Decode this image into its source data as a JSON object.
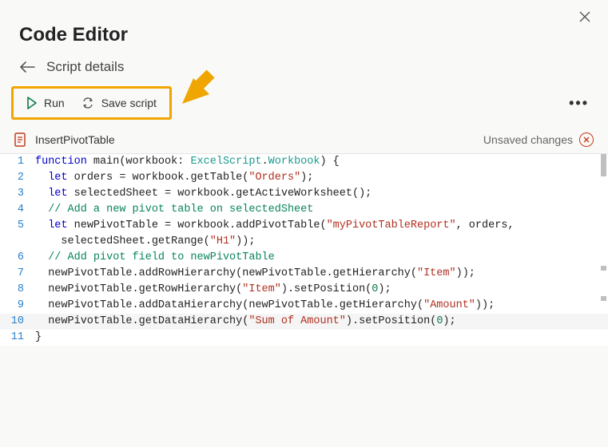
{
  "header": {
    "title": "Code Editor"
  },
  "breadcrumb": {
    "label": "Script details"
  },
  "toolbar": {
    "run_label": "Run",
    "save_label": "Save script"
  },
  "file": {
    "name": "InsertPivotTable",
    "status": "Unsaved changes"
  },
  "code": {
    "lines": [
      {
        "n": "1",
        "tokens": [
          {
            "t": "kw",
            "v": "function"
          },
          {
            "t": "plain",
            "v": " main(workbook: "
          },
          {
            "t": "type",
            "v": "ExcelScript"
          },
          {
            "t": "plain",
            "v": "."
          },
          {
            "t": "type",
            "v": "Workbook"
          },
          {
            "t": "plain",
            "v": ") {"
          }
        ],
        "indent": 0
      },
      {
        "n": "2",
        "tokens": [
          {
            "t": "kw",
            "v": "let"
          },
          {
            "t": "plain",
            "v": " orders = workbook.getTable("
          },
          {
            "t": "str",
            "v": "\"Orders\""
          },
          {
            "t": "plain",
            "v": ");"
          }
        ],
        "indent": 1
      },
      {
        "n": "3",
        "tokens": [
          {
            "t": "kw",
            "v": "let"
          },
          {
            "t": "plain",
            "v": " selectedSheet = workbook.getActiveWorksheet();"
          }
        ],
        "indent": 1
      },
      {
        "n": "4",
        "tokens": [
          {
            "t": "cmt",
            "v": "// Add a new pivot table on selectedSheet"
          }
        ],
        "indent": 1
      },
      {
        "n": "5",
        "tokens": [
          {
            "t": "kw",
            "v": "let"
          },
          {
            "t": "plain",
            "v": " newPivotTable = workbook.addPivotTable("
          },
          {
            "t": "str",
            "v": "\"myPivotTableReport\""
          },
          {
            "t": "plain",
            "v": ", orders,"
          }
        ],
        "indent": 1
      },
      {
        "n": "5b",
        "continuation": true,
        "tokens": [
          {
            "t": "plain",
            "v": "selectedSheet.getRange("
          },
          {
            "t": "str",
            "v": "\"H1\""
          },
          {
            "t": "plain",
            "v": "));"
          }
        ],
        "indent": 2
      },
      {
        "n": "6",
        "tokens": [
          {
            "t": "cmt",
            "v": "// Add pivot field to newPivotTable"
          }
        ],
        "indent": 1
      },
      {
        "n": "7",
        "tokens": [
          {
            "t": "plain",
            "v": "newPivotTable.addRowHierarchy(newPivotTable.getHierarchy("
          },
          {
            "t": "str",
            "v": "\"Item\""
          },
          {
            "t": "plain",
            "v": "));"
          }
        ],
        "indent": 1
      },
      {
        "n": "8",
        "tokens": [
          {
            "t": "plain",
            "v": "newPivotTable.getRowHierarchy("
          },
          {
            "t": "str",
            "v": "\"Item\""
          },
          {
            "t": "plain",
            "v": ").setPosition("
          },
          {
            "t": "num",
            "v": "0"
          },
          {
            "t": "plain",
            "v": ");"
          }
        ],
        "indent": 1
      },
      {
        "n": "9",
        "tokens": [
          {
            "t": "plain",
            "v": "newPivotTable.addDataHierarchy(newPivotTable.getHierarchy("
          },
          {
            "t": "str",
            "v": "\"Amount\""
          },
          {
            "t": "plain",
            "v": "));"
          }
        ],
        "indent": 1
      },
      {
        "n": "10",
        "tokens": [
          {
            "t": "plain",
            "v": "newPivotTable.getDataHierarchy("
          },
          {
            "t": "str",
            "v": "\"Sum of Amount\""
          },
          {
            "t": "plain",
            "v": ").setPosition("
          },
          {
            "t": "num",
            "v": "0"
          },
          {
            "t": "plain",
            "v": ");"
          }
        ],
        "indent": 1,
        "highlight": true
      },
      {
        "n": "11",
        "tokens": [
          {
            "t": "plain",
            "v": "}"
          }
        ],
        "indent": 0
      }
    ]
  }
}
